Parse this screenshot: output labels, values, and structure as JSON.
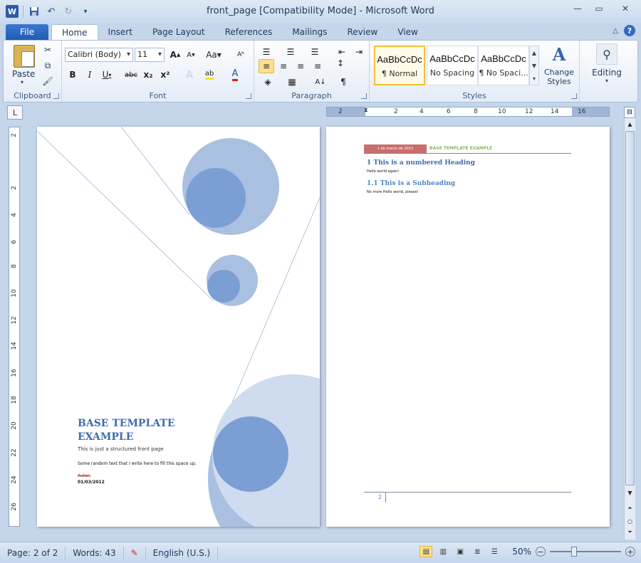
{
  "window": {
    "title": "front_page [Compatibility Mode]  -  Microsoft Word",
    "app_icon": "W"
  },
  "tabs": [
    {
      "label": "File"
    },
    {
      "label": "Home"
    },
    {
      "label": "Insert"
    },
    {
      "label": "Page Layout"
    },
    {
      "label": "References"
    },
    {
      "label": "Mailings"
    },
    {
      "label": "Review"
    },
    {
      "label": "View"
    }
  ],
  "ribbon": {
    "clipboard": {
      "label": "Clipboard",
      "paste_label": "Paste"
    },
    "font": {
      "label": "Font",
      "font_name": "Calibri (Body)",
      "font_size": "11"
    },
    "paragraph": {
      "label": "Paragraph"
    },
    "styles": {
      "label": "Styles",
      "items": [
        {
          "preview": "AaBbCcDc",
          "name": "¶ Normal"
        },
        {
          "preview": "AaBbCcDc",
          "name": "No Spacing"
        },
        {
          "preview": "AaBbCcDc",
          "name": "¶ No Spaci..."
        }
      ],
      "change_styles": "Change\nStyles"
    },
    "editing": {
      "label": "Editing"
    }
  },
  "hruler_labels": [
    "2",
    "2",
    "4",
    "6",
    "8",
    "10",
    "12",
    "14",
    "16"
  ],
  "vruler_labels": [
    "2",
    "2",
    "4",
    "6",
    "8",
    "10",
    "12",
    "14",
    "16",
    "18",
    "20",
    "22",
    "24",
    "26"
  ],
  "document": {
    "cover": {
      "title": "BASE TEMPLATE EXAMPLE",
      "subtitle": "This is just a structured front page",
      "body": "Some random text that I write here to fill this space up.",
      "author": "Autor,",
      "date": "01/03/2012"
    },
    "page2": {
      "header_date": "1 de marzo de 2012",
      "header_title": "BASE TEMPLATE EXAMPLE",
      "heading1": "1   This is a numbered  Heading",
      "text1": "Hello world again!",
      "heading2": "1.1   This is a  Subheading",
      "text2": "No more Hello world, please!",
      "page_number": "2"
    }
  },
  "status": {
    "page": "Page: 2 of 2",
    "words": "Words: 43",
    "language": "English (U.S.)",
    "zoom": "50%"
  },
  "colors": {
    "accent": "#3e6cb0",
    "circle_light": "#a9c0e0",
    "circle_mid": "#cfdcef",
    "circle_dark": "#7b9fd4"
  }
}
